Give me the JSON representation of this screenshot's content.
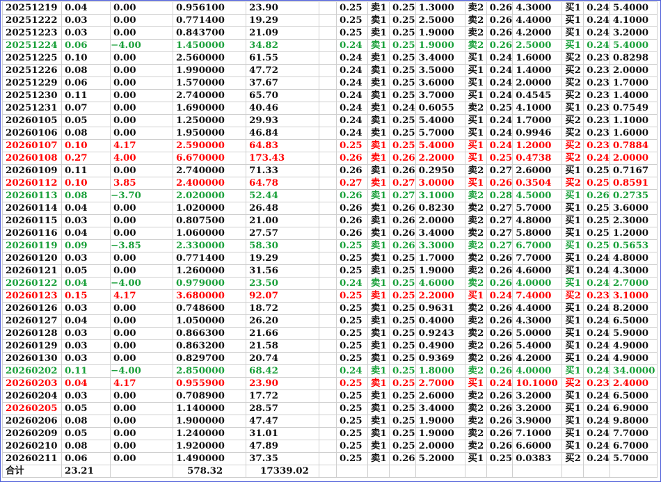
{
  "colors": {
    "up": "#ff0000",
    "down": "#1aa03a",
    "flat": "#111111"
  },
  "rows": [
    {
      "t": "flat",
      "c": [
        "20251219",
        "0.04",
        "0.00",
        "0.956100",
        "23.90",
        "0.25",
        "卖1",
        "0.25",
        "1.3000",
        "卖2",
        "0.26",
        "4.3000",
        "买1",
        "0.24",
        "5.4000"
      ]
    },
    {
      "t": "flat",
      "c": [
        "20251222",
        "0.03",
        "0.00",
        "0.771400",
        "19.29",
        "0.25",
        "卖1",
        "0.25",
        "2.5000",
        "卖2",
        "0.26",
        "4.4000",
        "买1",
        "0.24",
        "4.1000"
      ]
    },
    {
      "t": "flat",
      "c": [
        "20251223",
        "0.03",
        "0.00",
        "0.843700",
        "21.09",
        "0.25",
        "卖1",
        "0.25",
        "1.9000",
        "卖2",
        "0.26",
        "4.2000",
        "买1",
        "0.24",
        "3.2000"
      ]
    },
    {
      "t": "down",
      "c": [
        "20251224",
        "0.06",
        "−4.00",
        "1.450000",
        "34.82",
        "0.24",
        "卖1",
        "0.25",
        "1.9000",
        "卖2",
        "0.26",
        "2.5000",
        "买1",
        "0.24",
        "5.4000"
      ]
    },
    {
      "t": "flat",
      "c": [
        "20251225",
        "0.10",
        "0.00",
        "2.560000",
        "61.55",
        "0.24",
        "卖1",
        "0.25",
        "3.4000",
        "买1",
        "0.24",
        "1.6000",
        "买2",
        "0.23",
        "0.8298"
      ]
    },
    {
      "t": "flat",
      "c": [
        "20251226",
        "0.08",
        "0.00",
        "1.990000",
        "47.72",
        "0.24",
        "卖1",
        "0.25",
        "3.5000",
        "买1",
        "0.24",
        "1.4000",
        "买2",
        "0.23",
        "2.0000"
      ]
    },
    {
      "t": "flat",
      "c": [
        "20251229",
        "0.06",
        "0.00",
        "1.570000",
        "37.67",
        "0.24",
        "卖1",
        "0.25",
        "3.6000",
        "买1",
        "0.24",
        "2.0000",
        "买2",
        "0.23",
        "1.7000"
      ]
    },
    {
      "t": "flat",
      "c": [
        "20251230",
        "0.11",
        "0.00",
        "2.740000",
        "65.70",
        "0.24",
        "卖1",
        "0.25",
        "3.7000",
        "买1",
        "0.24",
        "0.4545",
        "买2",
        "0.23",
        "1.4000"
      ]
    },
    {
      "t": "flat",
      "c": [
        "20251231",
        "0.07",
        "0.00",
        "1.690000",
        "40.46",
        "0.24",
        "卖1",
        "0.24",
        "0.6055",
        "卖2",
        "0.25",
        "4.1000",
        "买1",
        "0.23",
        "0.7549"
      ]
    },
    {
      "t": "flat",
      "c": [
        "20260105",
        "0.05",
        "0.00",
        "1.250000",
        "29.93",
        "0.24",
        "卖1",
        "0.25",
        "5.4000",
        "买1",
        "0.24",
        "1.7000",
        "买2",
        "0.23",
        "1.1000"
      ]
    },
    {
      "t": "flat",
      "c": [
        "20260106",
        "0.08",
        "0.00",
        "1.950000",
        "46.84",
        "0.24",
        "卖1",
        "0.25",
        "5.7000",
        "买1",
        "0.24",
        "0.9946",
        "买2",
        "0.23",
        "1.6000"
      ]
    },
    {
      "t": "up",
      "c": [
        "20260107",
        "0.10",
        "4.17",
        "2.590000",
        "64.83",
        "0.25",
        "卖1",
        "0.25",
        "5.4000",
        "买1",
        "0.24",
        "1.2000",
        "买2",
        "0.23",
        "0.7884"
      ]
    },
    {
      "t": "up",
      "c": [
        "20260108",
        "0.27",
        "4.00",
        "6.670000",
        "173.43",
        "0.26",
        "卖1",
        "0.26",
        "2.2000",
        "买1",
        "0.25",
        "0.4738",
        "买2",
        "0.24",
        "2.0000"
      ]
    },
    {
      "t": "flat",
      "c": [
        "20260109",
        "0.11",
        "0.00",
        "2.740000",
        "71.33",
        "0.26",
        "卖1",
        "0.26",
        "0.2950",
        "卖2",
        "0.27",
        "2.6000",
        "买1",
        "0.25",
        "0.7167"
      ]
    },
    {
      "t": "up",
      "c": [
        "20260112",
        "0.10",
        "3.85",
        "2.400000",
        "64.78",
        "0.27",
        "卖1",
        "0.27",
        "3.0000",
        "买1",
        "0.26",
        "0.3504",
        "买2",
        "0.25",
        "0.8591"
      ]
    },
    {
      "t": "down",
      "c": [
        "20260113",
        "0.08",
        "−3.70",
        "2.020000",
        "52.44",
        "0.26",
        "卖1",
        "0.27",
        "3.1000",
        "卖2",
        "0.28",
        "4.5000",
        "买1",
        "0.26",
        "0.2735"
      ]
    },
    {
      "t": "flat",
      "c": [
        "20260114",
        "0.04",
        "0.00",
        "1.020000",
        "26.48",
        "0.26",
        "卖1",
        "0.26",
        "0.8230",
        "卖2",
        "0.27",
        "5.7000",
        "买1",
        "0.25",
        "3.6000"
      ]
    },
    {
      "t": "flat",
      "c": [
        "20260115",
        "0.03",
        "0.00",
        "0.807500",
        "21.00",
        "0.26",
        "卖1",
        "0.26",
        "2.0000",
        "卖2",
        "0.27",
        "4.8000",
        "买1",
        "0.25",
        "2.3000"
      ]
    },
    {
      "t": "flat",
      "c": [
        "20260116",
        "0.04",
        "0.00",
        "1.060000",
        "27.57",
        "0.26",
        "卖1",
        "0.26",
        "3.4000",
        "卖2",
        "0.27",
        "5.8000",
        "买1",
        "0.25",
        "1.2000"
      ]
    },
    {
      "t": "down",
      "c": [
        "20260119",
        "0.09",
        "−3.85",
        "2.330000",
        "58.30",
        "0.25",
        "卖1",
        "0.26",
        "3.3000",
        "卖2",
        "0.27",
        "6.7000",
        "买1",
        "0.25",
        "0.5653"
      ]
    },
    {
      "t": "flat",
      "c": [
        "20260120",
        "0.03",
        "0.00",
        "0.771400",
        "19.29",
        "0.25",
        "卖1",
        "0.25",
        "1.7000",
        "卖2",
        "0.26",
        "7.7000",
        "买1",
        "0.24",
        "4.8000"
      ]
    },
    {
      "t": "flat",
      "c": [
        "20260121",
        "0.05",
        "0.00",
        "1.260000",
        "31.56",
        "0.25",
        "卖1",
        "0.25",
        "1.9000",
        "卖2",
        "0.26",
        "4.6000",
        "买1",
        "0.24",
        "4.3000"
      ]
    },
    {
      "t": "down",
      "c": [
        "20260122",
        "0.04",
        "−4.00",
        "0.979000",
        "23.50",
        "0.24",
        "卖1",
        "0.25",
        "4.6000",
        "卖2",
        "0.26",
        "4.0000",
        "买1",
        "0.24",
        "2.7000"
      ]
    },
    {
      "t": "up",
      "c": [
        "20260123",
        "0.15",
        "4.17",
        "3.680000",
        "92.07",
        "0.25",
        "卖1",
        "0.25",
        "2.2000",
        "买1",
        "0.24",
        "7.4000",
        "买2",
        "0.23",
        "3.1000"
      ]
    },
    {
      "t": "flat",
      "c": [
        "20260126",
        "0.03",
        "0.00",
        "0.748600",
        "18.72",
        "0.25",
        "卖1",
        "0.25",
        "0.9631",
        "卖2",
        "0.26",
        "4.4000",
        "买1",
        "0.24",
        "8.2000"
      ]
    },
    {
      "t": "flat",
      "c": [
        "20260127",
        "0.04",
        "0.00",
        "1.050000",
        "26.20",
        "0.25",
        "卖1",
        "0.25",
        "0.4000",
        "卖2",
        "0.26",
        "4.3000",
        "买1",
        "0.24",
        "6.5000"
      ]
    },
    {
      "t": "flat",
      "c": [
        "20260128",
        "0.03",
        "0.00",
        "0.866300",
        "21.66",
        "0.25",
        "卖1",
        "0.25",
        "0.9243",
        "卖2",
        "0.26",
        "5.0000",
        "买1",
        "0.24",
        "5.9000"
      ]
    },
    {
      "t": "flat",
      "c": [
        "20260129",
        "0.03",
        "0.00",
        "0.863200",
        "21.58",
        "0.25",
        "卖1",
        "0.25",
        "0.4900",
        "卖2",
        "0.26",
        "5.4000",
        "买1",
        "0.24",
        "4.9000"
      ]
    },
    {
      "t": "flat",
      "c": [
        "20260130",
        "0.03",
        "0.00",
        "0.829700",
        "20.74",
        "0.25",
        "卖1",
        "0.25",
        "0.9369",
        "卖2",
        "0.26",
        "4.2000",
        "买1",
        "0.24",
        "4.9000"
      ]
    },
    {
      "t": "down",
      "c": [
        "20260202",
        "0.11",
        "−4.00",
        "2.850000",
        "68.42",
        "0.24",
        "卖1",
        "0.25",
        "1.8000",
        "卖2",
        "0.26",
        "4.0000",
        "买1",
        "0.24",
        "34.0000"
      ]
    },
    {
      "t": "up",
      "c": [
        "20260203",
        "0.04",
        "4.17",
        "0.955900",
        "23.90",
        "0.25",
        "卖1",
        "0.25",
        "2.7000",
        "买1",
        "0.24",
        "10.1000",
        "买2",
        "0.23",
        "2.4000"
      ]
    },
    {
      "t": "flat",
      "c": [
        "20260204",
        "0.03",
        "0.00",
        "0.708900",
        "17.72",
        "0.25",
        "卖1",
        "0.25",
        "2.6000",
        "卖2",
        "0.26",
        "3.2000",
        "买1",
        "0.24",
        "6.5000"
      ]
    },
    {
      "t": "flat",
      "datered": true,
      "c": [
        "20260205",
        "0.05",
        "0.00",
        "1.140000",
        "28.57",
        "0.25",
        "卖1",
        "0.25",
        "3.4000",
        "卖2",
        "0.26",
        "3.2000",
        "买1",
        "0.24",
        "6.9000"
      ]
    },
    {
      "t": "flat",
      "c": [
        "20260206",
        "0.08",
        "0.00",
        "1.900000",
        "47.47",
        "0.25",
        "卖1",
        "0.25",
        "1.9000",
        "卖2",
        "0.26",
        "3.9000",
        "买1",
        "0.24",
        "9.8000"
      ]
    },
    {
      "t": "flat",
      "c": [
        "20260209",
        "0.05",
        "0.00",
        "1.240000",
        "31.01",
        "0.25",
        "卖1",
        "0.25",
        "1.9000",
        "卖2",
        "0.26",
        "7.1000",
        "买1",
        "0.24",
        "7.7000"
      ]
    },
    {
      "t": "flat",
      "c": [
        "20260210",
        "0.08",
        "0.00",
        "1.920000",
        "47.89",
        "0.25",
        "卖1",
        "0.25",
        "2.0000",
        "卖2",
        "0.26",
        "6.6000",
        "买1",
        "0.24",
        "6.7000"
      ]
    },
    {
      "t": "flat",
      "c": [
        "20260211",
        "0.06",
        "0.00",
        "1.490000",
        "37.35",
        "0.25",
        "卖1",
        "0.26",
        "5.2000",
        "买1",
        "0.25",
        "0.0383",
        "买2",
        "0.24",
        "5.7000"
      ]
    }
  ],
  "totals": {
    "label": "合计",
    "col2": "23.21",
    "col4": "578.32",
    "col5": "17339.02"
  }
}
